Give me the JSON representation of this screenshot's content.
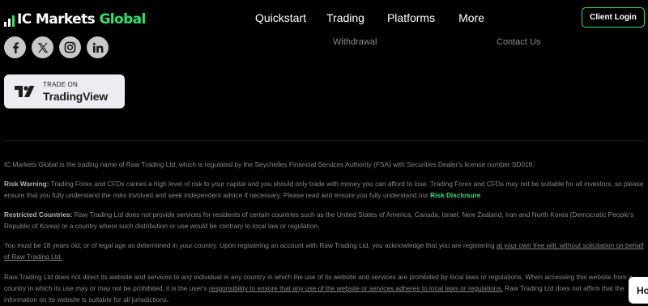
{
  "header": {
    "logo_part1": "IC Markets",
    "logo_part2": "Global",
    "nav": [
      "Quickstart",
      "Trading",
      "Platforms",
      "More"
    ],
    "client_login": "Client Login"
  },
  "footer_links": {
    "withdrawal": "Withdrawal",
    "contact_us": "Contact Us"
  },
  "social_icons": [
    "facebook-icon",
    "x-icon",
    "instagram-icon",
    "linkedin-icon"
  ],
  "tradingview_badge": {
    "small": "TRADE ON",
    "big": "TradingView"
  },
  "legal": {
    "p1": "IC Markets Global is the trading name of Raw Trading Ltd, which is regulated by the Seychelles Financial Services Authority (FSA) with Securities Dealer's license number SD018.",
    "risk_label": "Risk Warning:",
    "risk_text": " Trading Forex and CFDs carries a high level of risk to your capital and you should only trade with money you can afford to lose. Trading Forex and CFDs may not be suitable for all investors, so please ensure that you fully understand the risks involved and seek independent advice if necessary. Please read and ensure you fully understand our ",
    "risk_link": "Risk Disclosure",
    "restricted_label": "Restricted Countries:",
    "restricted_text": " Raw Trading Ltd does not provide services for residents of certain countries such as the United States of America, Canada, Israel, New Zealand, Iran and North Korea (Democratic People's Republic of Korea) or a country where such distribution or use would be contrary to local law or regulation.",
    "age_text": "You must be 18 years old, or of legal age as determined in your country. Upon registering an account with Raw Trading Ltd, you acknowledge that you are registering ",
    "age_link": "at your own free will, without solicitation on behalf of Raw Trading Ltd.",
    "direct_text_1": "Raw Trading Ltd does not direct its website and services to any individual in any country in which the use of its website and services are prohibited by local laws or regulations. When accessing this website from a country in which its use may or may not be prohibited, it is the user's ",
    "direct_link": "responsibility to ensure that any use of the website or services adheres to local laws or regulations.",
    "direct_text_2": " Raw Trading Ltd does not affirm that the information on its website is suitable for all jurisdictions."
  },
  "chat_widget": {
    "label": "Ho"
  },
  "colors": {
    "accent": "#2ee56a",
    "background": "#000000",
    "text": "#878787"
  }
}
